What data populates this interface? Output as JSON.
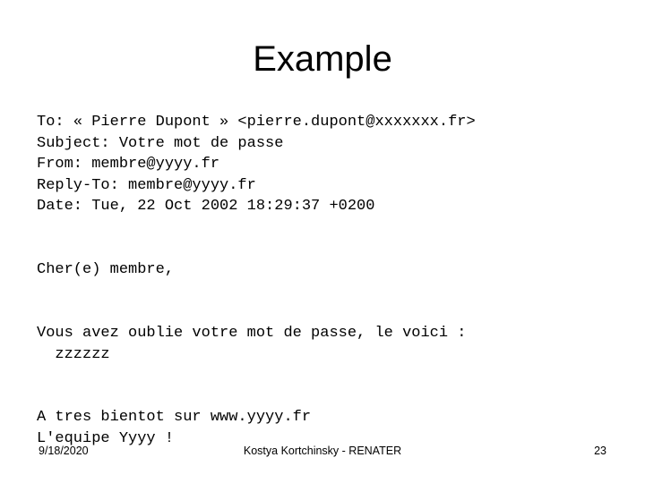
{
  "slide": {
    "title": "Example",
    "background_color": "#ffffff",
    "text_color": "#000000"
  },
  "body": {
    "lines": [
      "To: « Pierre Dupont » <pierre.dupont@xxxxxxx.fr>",
      "Subject: Votre mot de passe",
      "From: membre@yyyy.fr",
      "Reply-To: membre@yyyy.fr",
      "Date: Tue, 22 Oct 2002 18:29:37 +0200",
      "",
      "",
      "Cher(e) membre,",
      "",
      "",
      "Vous avez oublie votre mot de passe, le voici :",
      "  zzzzzz",
      "",
      "",
      "A tres bientot sur www.yyyy.fr",
      "L'equipe Yyyy !"
    ]
  },
  "footer": {
    "date": "9/18/2020",
    "center": "Kostya Kortchinsky - RENATER",
    "page_number": "23"
  }
}
